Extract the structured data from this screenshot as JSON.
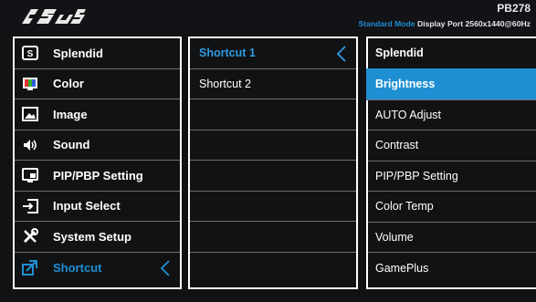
{
  "header": {
    "brand": "ASUS",
    "model": "PB278",
    "mode": "Standard Mode",
    "input": "Display Port",
    "resolution": "2560x1440@60Hz"
  },
  "colors": {
    "accent": "#1f8fd4",
    "background": "#111214"
  },
  "main_menu": [
    {
      "label": "Splendid",
      "icon": "splendid-icon"
    },
    {
      "label": "Color",
      "icon": "color-icon"
    },
    {
      "label": "Image",
      "icon": "image-icon"
    },
    {
      "label": "Sound",
      "icon": "speaker-icon"
    },
    {
      "label": "PIP/PBP Setting",
      "icon": "pip-icon"
    },
    {
      "label": "Input Select",
      "icon": "input-icon"
    },
    {
      "label": "System Setup",
      "icon": "tools-icon"
    },
    {
      "label": "Shortcut",
      "icon": "shortcut-icon",
      "active": true
    }
  ],
  "submenu": [
    "Shortcut 1",
    "Shortcut 2",
    "",
    "",
    "",
    "",
    "",
    ""
  ],
  "options": [
    "Splendid",
    "Brightness",
    "AUTO Adjust",
    "Contrast",
    "PIP/PBP Setting",
    "Color Temp",
    "Volume",
    "GamePlus"
  ],
  "selected_option": "Brightness"
}
